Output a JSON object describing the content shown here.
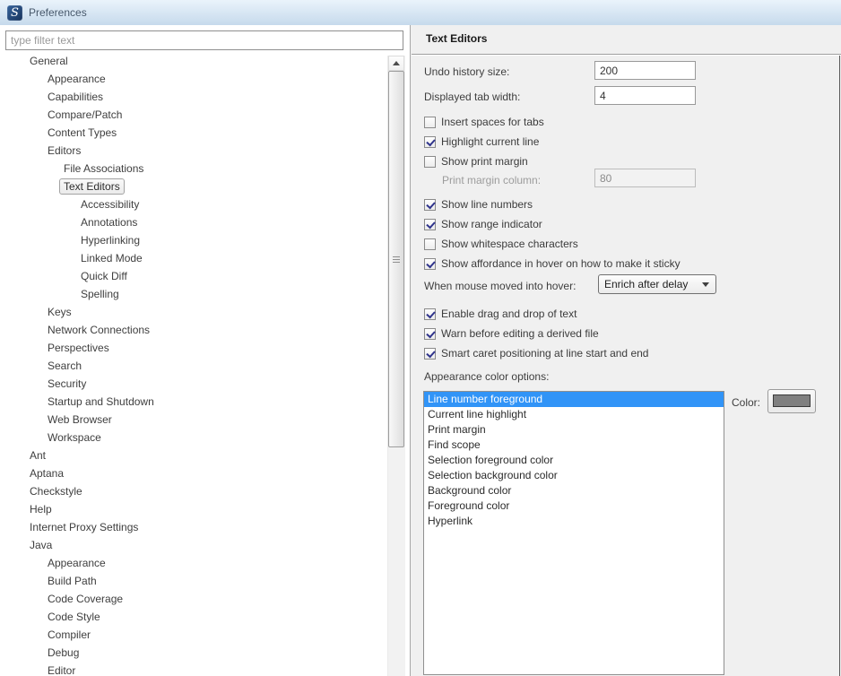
{
  "window": {
    "title": "Preferences"
  },
  "filter": {
    "value": "type filter text"
  },
  "tree": {
    "items": [
      {
        "label": "General",
        "level": 0
      },
      {
        "label": "Appearance",
        "level": 1
      },
      {
        "label": "Capabilities",
        "level": 1
      },
      {
        "label": "Compare/Patch",
        "level": 1
      },
      {
        "label": "Content Types",
        "level": 1
      },
      {
        "label": "Editors",
        "level": 1
      },
      {
        "label": "File Associations",
        "level": 2
      },
      {
        "label": "Text Editors",
        "level": 2,
        "selected": true
      },
      {
        "label": "Accessibility",
        "level": 3
      },
      {
        "label": "Annotations",
        "level": 3
      },
      {
        "label": "Hyperlinking",
        "level": 3
      },
      {
        "label": "Linked Mode",
        "level": 3
      },
      {
        "label": "Quick Diff",
        "level": 3
      },
      {
        "label": "Spelling",
        "level": 3
      },
      {
        "label": "Keys",
        "level": 1
      },
      {
        "label": "Network Connections",
        "level": 1
      },
      {
        "label": "Perspectives",
        "level": 1
      },
      {
        "label": "Search",
        "level": 1
      },
      {
        "label": "Security",
        "level": 1
      },
      {
        "label": "Startup and Shutdown",
        "level": 1
      },
      {
        "label": "Web Browser",
        "level": 1
      },
      {
        "label": "Workspace",
        "level": 1
      },
      {
        "label": "Ant",
        "level": 0
      },
      {
        "label": "Aptana",
        "level": 0
      },
      {
        "label": "Checkstyle",
        "level": 0
      },
      {
        "label": "Help",
        "level": 0
      },
      {
        "label": "Internet Proxy Settings",
        "level": 0
      },
      {
        "label": "Java",
        "level": 0
      },
      {
        "label": "Appearance",
        "level": 1
      },
      {
        "label": "Build Path",
        "level": 1
      },
      {
        "label": "Code Coverage",
        "level": 1
      },
      {
        "label": "Code Style",
        "level": 1
      },
      {
        "label": "Compiler",
        "level": 1
      },
      {
        "label": "Debug",
        "level": 1
      },
      {
        "label": "Editor",
        "level": 1
      }
    ]
  },
  "panel": {
    "title": "Text Editors",
    "undo": {
      "label": "Undo history size:",
      "value": "200"
    },
    "tab_width": {
      "label": "Displayed tab width:",
      "value": "4"
    },
    "checkbox_group1": [
      {
        "label": "Insert spaces for tabs",
        "checked": false
      },
      {
        "label": "Highlight current line",
        "checked": true
      },
      {
        "label": "Show print margin",
        "checked": false
      }
    ],
    "print_margin": {
      "label": "Print margin column:",
      "value": "80"
    },
    "checkbox_group2": [
      {
        "label": "Show line numbers",
        "checked": true
      },
      {
        "label": "Show range indicator",
        "checked": true
      },
      {
        "label": "Show whitespace characters",
        "checked": false
      },
      {
        "label": "Show affordance in hover on how to make it sticky",
        "checked": true
      }
    ],
    "hover_combo": {
      "label": "When mouse moved into hover:",
      "value": "Enrich after delay"
    },
    "checkbox_group3": [
      {
        "label": "Enable drag and drop of text",
        "checked": true
      },
      {
        "label": "Warn before editing a derived file",
        "checked": true
      },
      {
        "label": "Smart caret positioning at line start and end",
        "checked": true
      }
    ],
    "color_options": {
      "label": "Appearance color options:",
      "items": [
        "Line number foreground",
        "Current line highlight",
        "Print margin",
        "Find scope",
        "Selection foreground color",
        "Selection background color",
        "Background color",
        "Foreground color",
        "Hyperlink"
      ],
      "selected_index": 0,
      "selection_color": "#3194f7",
      "color_label": "Color:",
      "swatch_color": "#808080"
    }
  }
}
